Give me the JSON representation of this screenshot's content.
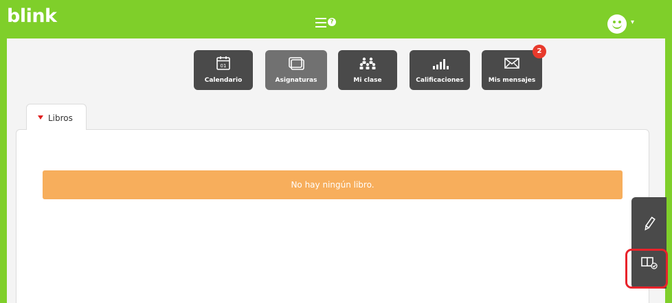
{
  "header": {
    "logo": "blink",
    "menu_icon": "hamburger-icon",
    "help_icon": "help-icon",
    "help_glyph": "?",
    "avatar_icon": "smiley-avatar-icon",
    "caret": "▾"
  },
  "nav": {
    "calendar": {
      "label": "Calendario",
      "day": "01",
      "icon": "calendar-icon"
    },
    "subjects": {
      "label": "Asignaturas",
      "icon": "subjects-icon"
    },
    "myclass": {
      "label": "Mi clase",
      "icon": "class-people-icon"
    },
    "grades": {
      "label": "Calificaciones",
      "icon": "bar-chart-icon"
    },
    "messages": {
      "label": "Mis mensajes",
      "icon": "envelope-icon",
      "badge": "2"
    }
  },
  "tabs": {
    "books": {
      "label": "Libros"
    }
  },
  "books": {
    "empty_message": "No hay ningún libro."
  },
  "tools": {
    "edit_icon": "pencil-icon",
    "book_icon": "book-check-icon"
  },
  "colors": {
    "brand": "#7fcf2a",
    "tile": "#4a4a4a",
    "tile_active": "#717171",
    "alert": "#f7ae5c",
    "badge": "#e83a2c",
    "highlight": "#e8232b"
  }
}
